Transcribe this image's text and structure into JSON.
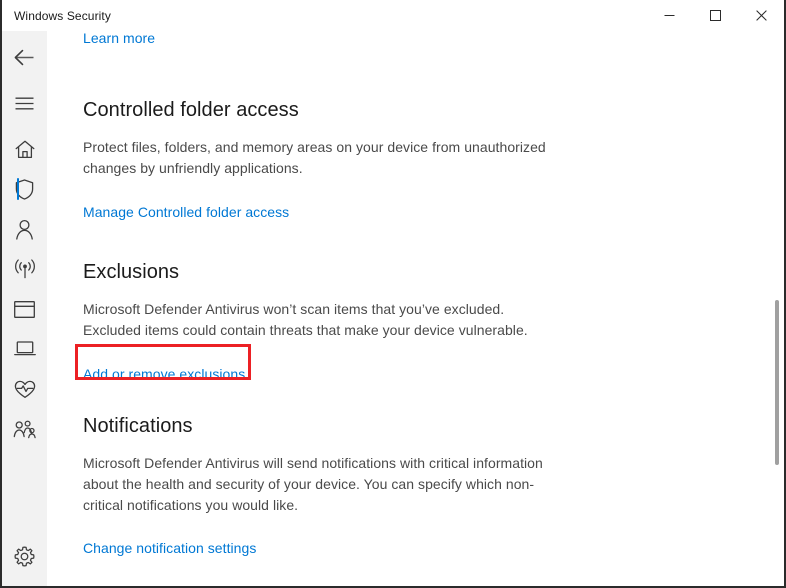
{
  "window": {
    "title": "Windows Security",
    "caption_buttons": [
      {
        "name": "minimize",
        "label": "Minimize"
      },
      {
        "name": "maximize",
        "label": "Maximize"
      },
      {
        "name": "close",
        "label": "Close"
      }
    ]
  },
  "colors": {
    "accent": "#0078d4",
    "link": "#0078d4",
    "annotation": "#ec2024",
    "rail_bg": "#f2f2f2",
    "heading": "#1b1b1b",
    "body_text": "#4a4a4a"
  },
  "nav": {
    "top_items": [
      {
        "icon": "back-arrow-icon",
        "label": "Back",
        "selected": false
      },
      {
        "icon": "hamburger-menu-icon",
        "label": "Open navigation",
        "selected": false
      },
      {
        "icon": "home-icon",
        "label": "Home",
        "selected": false
      },
      {
        "icon": "shield-icon",
        "label": "Virus & threat protection",
        "selected": true
      },
      {
        "icon": "person-icon",
        "label": "Account protection",
        "selected": false
      },
      {
        "icon": "wifi-signal-icon",
        "label": "Firewall & network protection",
        "selected": false
      },
      {
        "icon": "app-window-icon",
        "label": "App & browser control",
        "selected": false
      },
      {
        "icon": "laptop-icon",
        "label": "Device security",
        "selected": false
      },
      {
        "icon": "heart-pulse-icon",
        "label": "Device performance & health",
        "selected": false
      },
      {
        "icon": "family-people-icon",
        "label": "Family options",
        "selected": false
      }
    ],
    "bottom_items": [
      {
        "icon": "gear-icon",
        "label": "Settings",
        "selected": false
      }
    ]
  },
  "content": {
    "learn_more_link": "Learn more",
    "sections": [
      {
        "id": "controlled-folder-access",
        "title": "Controlled folder access",
        "body": "Protect files, folders, and memory areas on your device from unauthorized changes by unfriendly applications.",
        "link": "Manage Controlled folder access",
        "highlighted": false
      },
      {
        "id": "exclusions",
        "title": "Exclusions",
        "body": "Microsoft Defender Antivirus won’t scan items that you’ve excluded. Excluded items could contain threats that make your device vulnerable.",
        "link": "Add or remove exclusions",
        "highlighted": true
      },
      {
        "id": "notifications",
        "title": "Notifications",
        "body": "Microsoft Defender Antivirus will send notifications with critical information about the health and security of your device. You can specify which non-critical notifications you would like.",
        "link": "Change notification settings",
        "highlighted": false
      }
    ]
  }
}
